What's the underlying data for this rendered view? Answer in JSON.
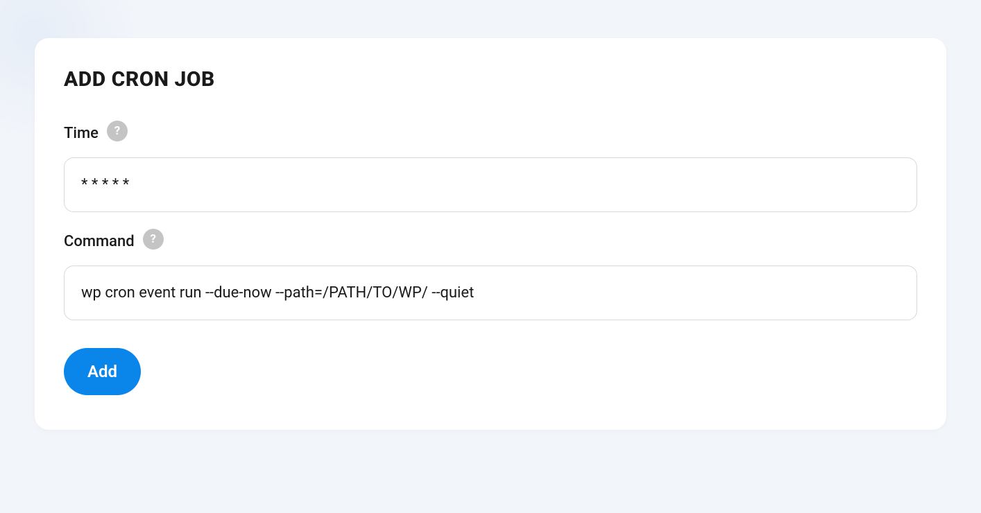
{
  "card": {
    "title": "ADD CRON JOB",
    "fields": {
      "time": {
        "label": "Time",
        "value": "* * * * *",
        "help_icon": "?"
      },
      "command": {
        "label": "Command",
        "value": "wp cron event run --due-now --path=/PATH/TO/WP/ --quiet",
        "help_icon": "?"
      }
    },
    "buttons": {
      "add": "Add"
    }
  }
}
